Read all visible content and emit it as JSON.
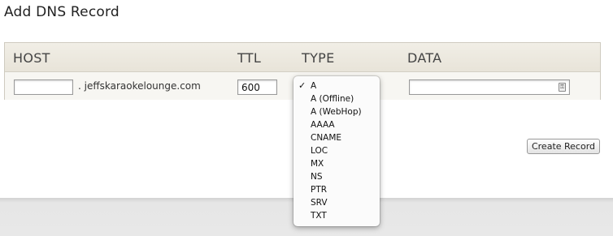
{
  "page": {
    "title": "Add DNS Record"
  },
  "table": {
    "headers": {
      "host": "HOST",
      "ttl": "TTL",
      "type": "TYPE",
      "data": "DATA"
    },
    "row": {
      "host_value": "",
      "domain_suffix": ". jeffskaraokelounge.com",
      "ttl_value": "600",
      "type_selected": "A",
      "data_value": ""
    }
  },
  "type_dropdown": {
    "selected_index": 0,
    "options": [
      "A",
      "A (Offline)",
      "A (WebHop)",
      "AAAA",
      "CNAME",
      "LOC",
      "MX",
      "NS",
      "PTR",
      "SRV",
      "TXT"
    ]
  },
  "buttons": {
    "create_record": "Create Record"
  },
  "icons": {
    "check": "checkmark-icon",
    "data_field": "key-icon"
  },
  "colors": {
    "header_bg": "#ece9e0",
    "row_bg": "#f7f6f2",
    "footer_bg": "#e6e6e6"
  }
}
